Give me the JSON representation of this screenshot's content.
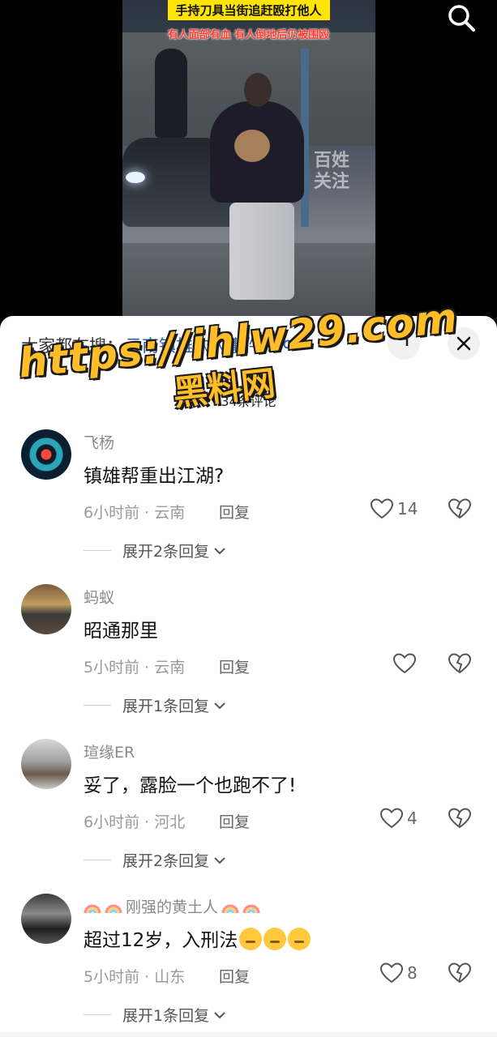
{
  "video": {
    "headline": "手持刀具当街追赶殴打他人",
    "subheadline": "有人面部有血 有人倒地后仍被围殴",
    "watermark": "百姓关注",
    "search_icon": "search-icon"
  },
  "sheet": {
    "search_prefix": "大家都在搜：",
    "search_term": "云南镇雄砍人事件...",
    "comment_count": "34条评论",
    "close_icon": "close-icon"
  },
  "overlay": {
    "url": "https://ihlw29.com",
    "name": "黑料网",
    "color": "#ffbe27"
  },
  "comments": [
    {
      "username": "飞杨",
      "text": "镇雄帮重出江湖?",
      "meta": "6小时前 · 云南",
      "reply": "回复",
      "likes": "14",
      "expand": "展开2条回复"
    },
    {
      "username": "蚂蚁",
      "text": "昭通那里",
      "meta": "5小时前 · 云南",
      "reply": "回复",
      "likes": "",
      "expand": "展开1条回复"
    },
    {
      "username": "瑄缘ER",
      "text": "妥了，露脸一个也跑不了!",
      "meta": "6小时前 · 河北",
      "reply": "回复",
      "likes": "4",
      "expand": "展开2条回复"
    },
    {
      "username": "刚强的黄土人",
      "text": "超过12岁，入刑法",
      "meta": "5小时前 · 山东",
      "reply": "回复",
      "likes": "8",
      "expand": "展开1条回复"
    }
  ]
}
